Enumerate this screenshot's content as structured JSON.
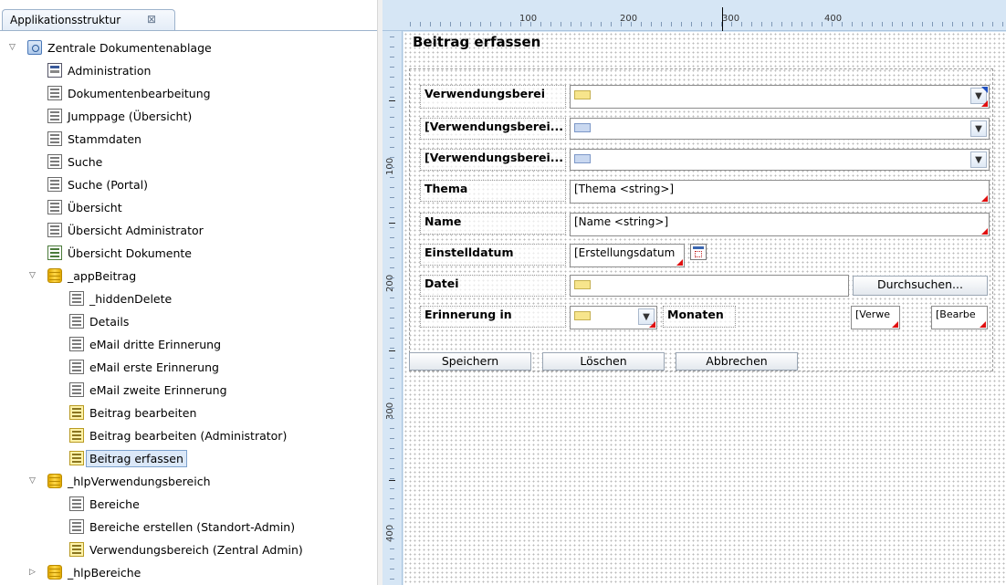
{
  "tree": {
    "tab_label": "Applikationsstruktur",
    "tab_close": "⊠",
    "nodes": [
      {
        "label": "Zentrale Dokumentenablage",
        "icon": "app-icon",
        "level": 0,
        "expanded": true
      },
      {
        "label": "Administration",
        "icon": "admin-form-icon",
        "level": 1
      },
      {
        "label": "Dokumentenbearbeitung",
        "icon": "form-icon",
        "level": 1
      },
      {
        "label": "Jumppage (Übersicht)",
        "icon": "form-icon",
        "level": 1
      },
      {
        "label": "Stammdaten",
        "icon": "form-icon",
        "level": 1
      },
      {
        "label": "Suche",
        "icon": "form-icon",
        "level": 1
      },
      {
        "label": "Suche (Portal)",
        "icon": "form-icon",
        "level": 1
      },
      {
        "label": "Übersicht",
        "icon": "form-icon",
        "level": 1
      },
      {
        "label": "Übersicht Administrator",
        "icon": "form-icon",
        "level": 1
      },
      {
        "label": "Übersicht Dokumente",
        "icon": "overview-form-icon",
        "level": 1
      },
      {
        "label": "_appBeitrag",
        "icon": "database-icon",
        "level": 1,
        "expanded": true
      },
      {
        "label": "_hiddenDelete",
        "icon": "form-icon",
        "level": 2
      },
      {
        "label": "Details",
        "icon": "form-icon",
        "level": 2
      },
      {
        "label": "eMail dritte Erinnerung",
        "icon": "form-icon",
        "level": 2
      },
      {
        "label": "eMail erste Erinnerung",
        "icon": "form-icon",
        "level": 2
      },
      {
        "label": "eMail zweite Erinnerung",
        "icon": "form-icon",
        "level": 2
      },
      {
        "label": "Beitrag bearbeiten",
        "icon": "yellow-form-icon",
        "level": 2
      },
      {
        "label": "Beitrag bearbeiten (Administrator)",
        "icon": "yellow-form-icon",
        "level": 2
      },
      {
        "label": "Beitrag erfassen",
        "icon": "yellow-form-icon",
        "level": 2,
        "selected": true
      },
      {
        "label": "_hlpVerwendungsbereich",
        "icon": "database-icon",
        "level": 1,
        "expanded": true
      },
      {
        "label": "Bereiche",
        "icon": "form-icon",
        "level": 2
      },
      {
        "label": "Bereiche erstellen (Standort-Admin)",
        "icon": "form-icon",
        "level": 2
      },
      {
        "label": "Verwendungsbereich (Zentral Admin)",
        "icon": "yellow-form-icon",
        "level": 2
      },
      {
        "label": "_hlpBereiche",
        "icon": "database-icon",
        "level": 1,
        "expanded": false
      }
    ]
  },
  "ruler": {
    "h_labels": [
      "100",
      "200",
      "300",
      "400"
    ],
    "v_labels": [
      "100",
      "200",
      "300",
      "400"
    ]
  },
  "form": {
    "title": "Beitrag erfassen",
    "labels": {
      "verwendungsbereich_1": "Verwendungsberei",
      "verwendungsbereich_2": "[Verwendungsberei...",
      "verwendungsbereich_3": "[Verwendungsberei...",
      "thema": "Thema",
      "name": "Name",
      "einstelldatum": "Einstelldatum",
      "datei": "Datei",
      "erinnerung": "Erinnerung in",
      "monaten": "Monaten"
    },
    "fields": {
      "thema": "[Thema <string>]",
      "name": "[Name <string>]",
      "einstelldatum": "[Erstellungsdatum",
      "verwe": "[Verwe",
      "bearbe": "[Bearbe"
    },
    "buttons": {
      "durchsuchen": "Durchsuchen...",
      "speichern": "Speichern",
      "loeschen": "Löschen",
      "abbrechen": "Abbrechen"
    },
    "dropdown_arrow": "▼"
  }
}
